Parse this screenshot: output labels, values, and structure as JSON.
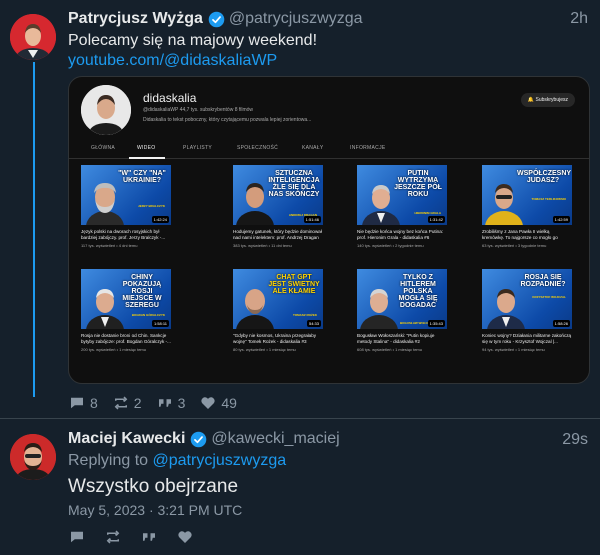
{
  "tweet1": {
    "name": "Patrycjusz Wyżga",
    "handle": "@patrycjuszwyzga",
    "time": "2h",
    "text": "Polecamy się na majowy weekend!",
    "link": "youtube.com/@didaskaliaWP",
    "actions": {
      "replies": "8",
      "retweets": "2",
      "quotes": "3",
      "likes": "49"
    }
  },
  "embed": {
    "channel_name": "didaskalia",
    "meta": "@didaskaliaWP  44,7 tys. subskrybentów  8 filmów",
    "description": "Didaskalia to tekst poboczny, który czytającemu pozwala lepiej zorientowa...",
    "subscribe": "Subskrybujesz",
    "tabs": [
      "GŁÓWNA",
      "WIDEO",
      "PLAYLISTY",
      "SPOŁECZNOŚĆ",
      "KANAŁY",
      "INFORMACJE"
    ],
    "active_tab": "WIDEO",
    "videos": [
      {
        "headline": "\"W\" CZY \"NA\" UKRAINIE?",
        "person": "JERZY BRALCZYK",
        "duration": "1:42:24",
        "title": "Język polski na dworach rosyjskich był bardziej zabójczy. prof. Jerzy Bralczyk -...",
        "meta": "117 tys. wyświetleń • 4 dni temu"
      },
      {
        "headline": "SZTUCZNA INTELIGENCJA ŻLE SIĘ DLA NAS SKOŃCZY",
        "person": "ANDRZEJ DRAGAN",
        "duration": "1:51:46",
        "title": "Hodujemy gatunek, który będzie dominował nad nami intelektem: prof. Andrzej Dragan ...",
        "meta": "383 tys. wyświetleń • 11 dni temu"
      },
      {
        "headline": "PUTIN WYTRZYMA JESZCZE PÓŁ ROKU",
        "person": "HIERONIM GRALA",
        "duration": "1:31:42",
        "title": "Nie będzie końca wojny bez końca Putina: prof. Hieronim Grala - didaskalia #6",
        "meta": "140 tys. wyświetleń • 2 tygodnie temu"
      },
      {
        "headline": "WSPÓŁCZESNY JUDASZ?",
        "person": "TOMASZ TERLIKOWSKI",
        "duration": "1:42:59",
        "title": "Zrobiliśmy z Jana Pawła II wielką kremówkę. To najgorsze co mogło go spotkać -...",
        "meta": "63 tys. wyświetleń • 3 tygodnie temu"
      },
      {
        "headline": "CHINY POKAZUJĄ ROSJI MIEJSCE W SZEREGU",
        "person": "BOGDAN GÓRALCZYK",
        "duration": "1:58:11",
        "title": "Rosja nie dostanie broni od Chin. Sankcje bytyby zabójcze: prof. Bogdan Góralczyk -...",
        "meta": "200 tys. wyświetleń • 1 miesiąc temu"
      },
      {
        "headline": "CHAT GPT JEST ŚWIETNY ALE KŁAMIE",
        "person": "TOMASZ ROŻEK",
        "duration": "54:33",
        "title": "\"Gdyby nie kosmos, Ukraina przegrałaby wojnę\" Tomek Rożek - didaskalia #3",
        "meta": "80 tys. wyświetleń • 1 miesiąc temu"
      },
      {
        "headline": "TYLKO Z HITLEREM POLSKA MOGŁA SIĘ DOGADAĆ",
        "person": "BOGUSŁAW WOŁOSZAŃSKI",
        "duration": "1:35:43",
        "title": "Bogusław Wołoszański: \"Putin kopiuje metody Stalina\" - didaskalia #2",
        "meta": "608 tys. wyświetleń • 1 miesiąc temu"
      },
      {
        "headline": "ROSJA SIĘ ROZPADNIE?",
        "person": "KRZYSZTOF WOJCZAL",
        "duration": "1:58:26",
        "title": "Koniec wojny? Działania militarne zakończą się w tym roku - Krzysztof Wojczal |...",
        "meta": "94 tys. wyświetleń • 1 miesiąc temu"
      }
    ]
  },
  "tweet2": {
    "name": "Maciej Kawecki",
    "handle": "@kawecki_maciej",
    "time": "29s",
    "replying_prefix": "Replying to",
    "replying_to": "@patrycjuszwyzga",
    "text": "Wszystko obejrzane",
    "date": "May 5, 2023 · 3:21 PM UTC"
  },
  "colors": {
    "background": "#15202b",
    "accent": "#1d9bf0",
    "muted": "#8b98a5",
    "text": "#e7e9ea"
  }
}
